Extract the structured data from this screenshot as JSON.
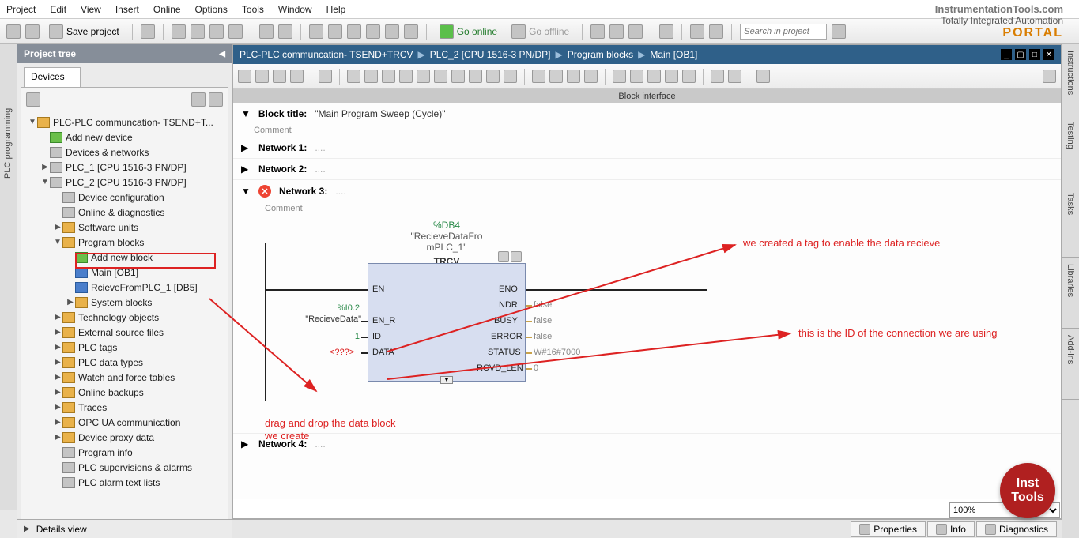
{
  "menu": {
    "items": [
      "Project",
      "Edit",
      "View",
      "Insert",
      "Online",
      "Options",
      "Tools",
      "Window",
      "Help"
    ]
  },
  "brand": {
    "site": "InstrumentationTools.com",
    "tia": "Totally Integrated Automation",
    "portal": "PORTAL"
  },
  "toolbar": {
    "save": "Save project",
    "go_online": "Go online",
    "go_offline": "Go offline",
    "search_placeholder": "Search in project"
  },
  "left_tab": "PLC programming",
  "project_tree": {
    "title": "Project tree",
    "devices_tab": "Devices",
    "root": "PLC-PLC communcation- TSEND+T...",
    "items": [
      "Add new device",
      "Devices & networks",
      "PLC_1 [CPU 1516-3 PN/DP]",
      "PLC_2 [CPU 1516-3 PN/DP]",
      "Device configuration",
      "Online & diagnostics",
      "Software units",
      "Program blocks",
      "Add new block",
      "Main [OB1]",
      "RcieveFromPLC_1 [DB5]",
      "System blocks",
      "Technology objects",
      "External source files",
      "PLC tags",
      "PLC data types",
      "Watch and force tables",
      "Online backups",
      "Traces",
      "OPC UA communication",
      "Device proxy data",
      "Program info",
      "PLC supervisions & alarms",
      "PLC alarm text lists"
    ]
  },
  "details_view": "Details view",
  "editor": {
    "crumbs": [
      "PLC-PLC communcation- TSEND+TRCV",
      "PLC_2 [CPU 1516-3 PN/DP]",
      "Program blocks",
      "Main [OB1]"
    ],
    "block_iface": "Block interface",
    "block_title_label": "Block title:",
    "block_title_val": "\"Main Program Sweep (Cycle)\"",
    "comment": "Comment",
    "networks": [
      "Network 1:",
      "Network 2:",
      "Network 3:",
      "Network 4:"
    ],
    "fb": {
      "db": "%DB4",
      "inst": "\"RecieveDataFro\nmPLC_1\"",
      "type": "TRCV",
      "ports_left": [
        "EN",
        "EN_R",
        "ID",
        "DATA"
      ],
      "ports_right": [
        "ENO",
        "NDR",
        "BUSY",
        "ERROR",
        "STATUS",
        "RCVD_LEN"
      ],
      "in_tag_addr": "%I0.2",
      "in_tag_name": "\"RecieveData\"",
      "in_id": "1",
      "in_data": "<???>",
      "out_ndr": "false",
      "out_busy": "false",
      "out_error": "false",
      "out_status": "W#16#7000",
      "out_rcvd": "0"
    }
  },
  "annotations": {
    "a1": "we created a tag to enable the data recieve",
    "a2": "this is the ID of the connection we are using",
    "a3a": "drag and drop the data block",
    "a3b": "we create"
  },
  "zoom": "100%",
  "bottom_tabs": {
    "props": "Properties",
    "info": "Info",
    "diag": "Diagnostics"
  },
  "right_tabs": [
    "Instructions",
    "Testing",
    "Tasks",
    "Libraries",
    "Add-ins"
  ],
  "badge": {
    "l1": "Inst",
    "l2": "Tools"
  }
}
